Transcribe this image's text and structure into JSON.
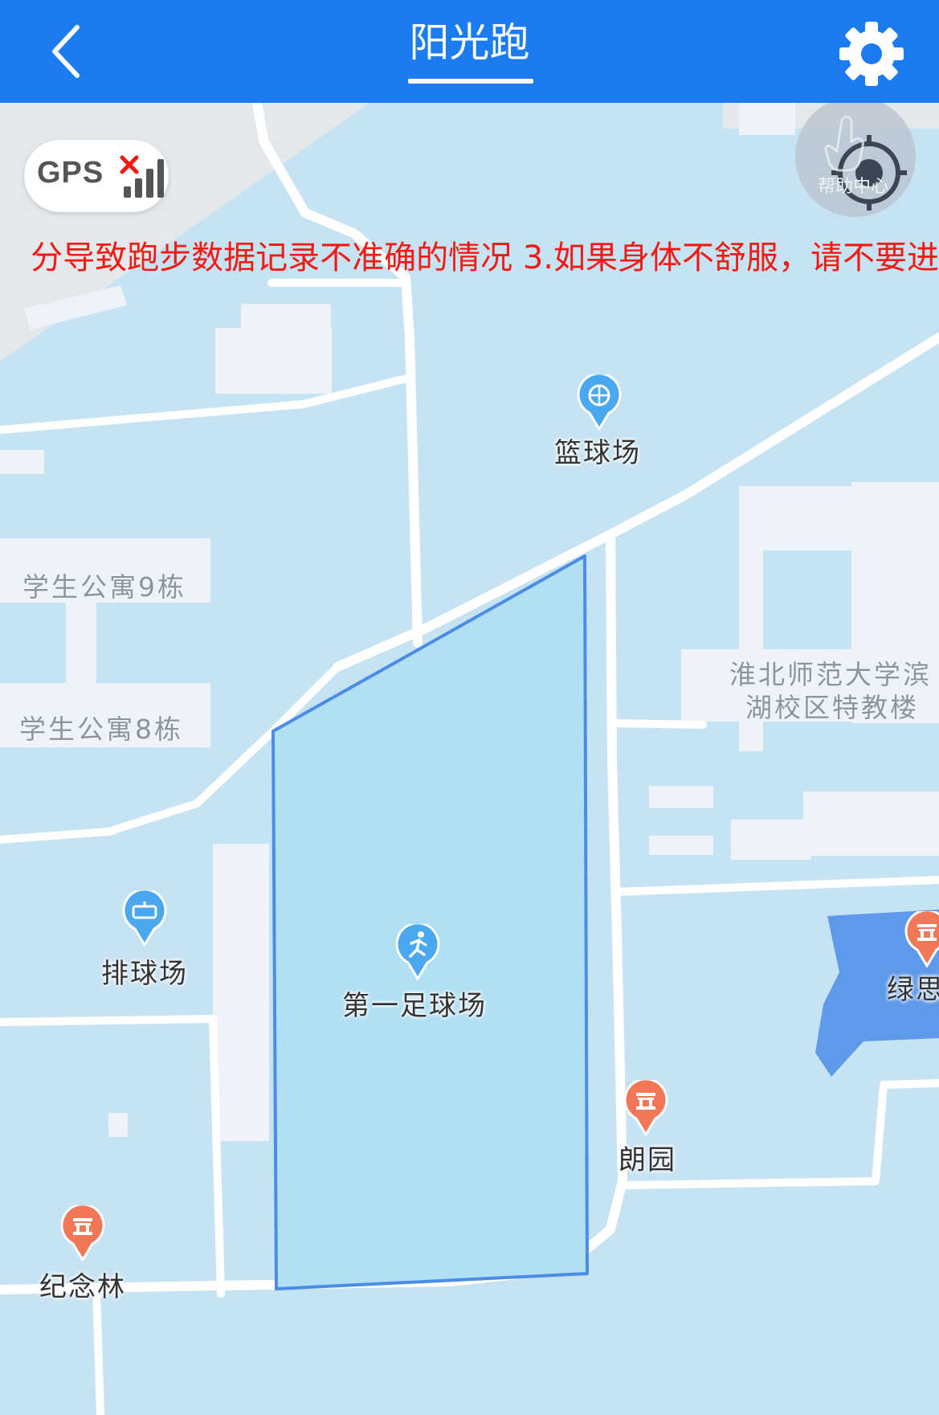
{
  "header": {
    "title": "阳光跑"
  },
  "status": {
    "gps_label": "GPS"
  },
  "notice": {
    "text": "分导致跑步数据记录不准确的情况 3.如果身体不舒服，请不要进"
  },
  "controls": {
    "help_label": "帮助中心"
  },
  "map": {
    "pois": [
      {
        "label": "篮球场",
        "icon": "basketball-icon"
      },
      {
        "label": "排球场",
        "icon": "volleyball-icon"
      },
      {
        "label": "第一足球场",
        "icon": "runner-icon"
      },
      {
        "label": "朗园",
        "icon": "landmark-icon"
      },
      {
        "label": "纪念林",
        "icon": "landmark-icon"
      },
      {
        "label": "绿思",
        "icon": "landmark-icon"
      }
    ],
    "building_labels": {
      "dorm9": "学生公寓9栋",
      "dorm8": "学生公寓8栋",
      "campus_line1": "淮北师范大学滨",
      "campus_line2": "湖校区特教楼"
    }
  },
  "colors": {
    "header_bg": "#1a7cf0",
    "map_bg": "#c6e3f3",
    "zone_fill": "#b1dff3",
    "zone_stroke": "#4b8de6",
    "notice_text": "#f21a12",
    "poi_blue": "#4aa8f0",
    "poi_orange": "#f07856"
  }
}
